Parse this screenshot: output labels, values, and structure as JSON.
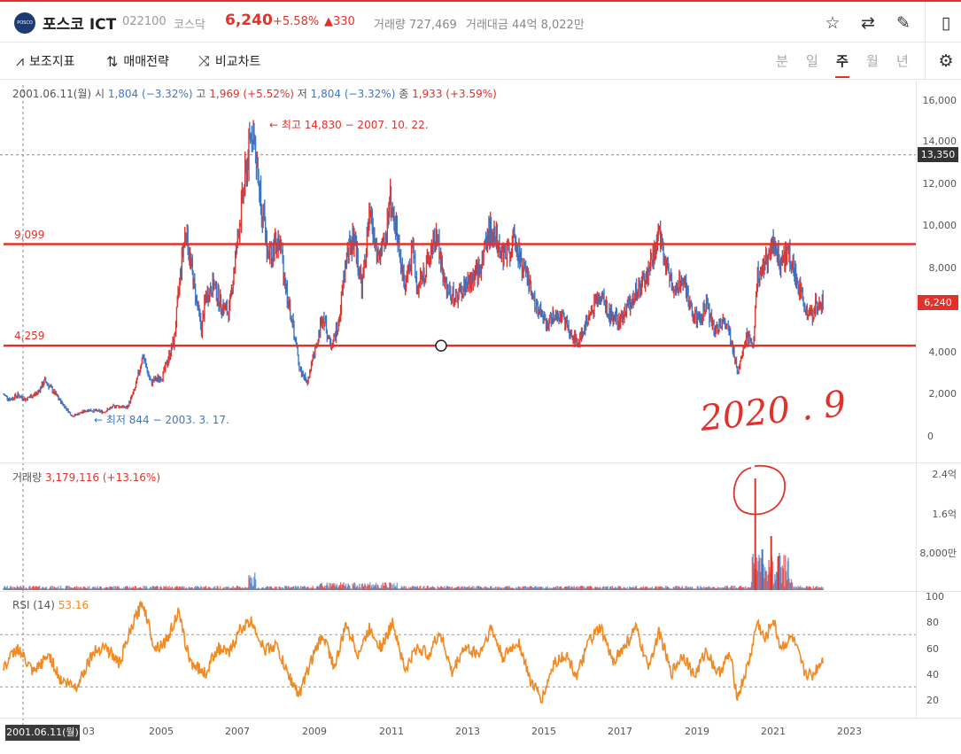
{
  "header": {
    "logo_text": "POSCO",
    "stock_name": "포스코 ICT",
    "stock_code": "022100",
    "market": "코스닥",
    "price": "6,240",
    "change_pct": "+5.58%",
    "change_abs": "▲330",
    "volume_label": "거래량 727,469",
    "amount_label": "거래대금 44억 8,022만",
    "icons": [
      "star-icon",
      "swap-icon",
      "edit-icon",
      "panel-icon"
    ]
  },
  "toolbar": {
    "indicator_label": "보조지표",
    "strategy_label": "매매전략",
    "compare_label": "비교차트",
    "periods": [
      "분",
      "일",
      "주",
      "월",
      "년"
    ],
    "active_period": "주"
  },
  "price_pane": {
    "info": {
      "date": "2001.06.11(월)",
      "open_label": "시",
      "open": "1,804 (−3.32%)",
      "high_label": "고",
      "high": "1,969 (+5.52%)",
      "low_label": "저",
      "low": "1,804 (−3.32%)",
      "close_label": "종",
      "close": "1,933 (+3.59%)"
    },
    "max_annotation": "← 최고 14,830 − 2007. 10. 22.",
    "min_annotation": "← 최저 844 − 2003. 3. 17.",
    "line_upper": "9,099",
    "line_lower": "4,259",
    "crosshair_price": "13,350",
    "current_price": "6,240",
    "handwritten_note": "2020 . 9",
    "y_ticks": [
      "16,000",
      "14,000",
      "12,000",
      "10,000",
      "8,000",
      "6,000",
      "4,000",
      "2,000",
      "0"
    ]
  },
  "volume_pane": {
    "label": "거래량",
    "value": "3,179,116 (+13.16%)",
    "y_ticks": [
      "2.4억",
      "1.6억",
      "8,000만"
    ]
  },
  "rsi_pane": {
    "label": "RSI (14)",
    "value": "53.16",
    "y_ticks": [
      "100",
      "80",
      "60",
      "40",
      "20"
    ]
  },
  "x_axis": {
    "date_tag": "2001.06.11(월)",
    "labels": [
      "03",
      "2005",
      "2007",
      "2009",
      "2011",
      "2013",
      "2015",
      "2017",
      "2019",
      "2021",
      "2023"
    ]
  },
  "colors": {
    "up": "#e0322b",
    "down": "#3b78c9",
    "rsi": "#f08a24",
    "support_line": "#e0322b"
  },
  "chart_data": {
    "type": "line",
    "title": "",
    "x_start": 2001.44,
    "x_end": 2022.4,
    "series": [
      {
        "name": "",
        "points": [
          [
            2001.44,
            1933
          ],
          [
            2001.6,
            1700
          ],
          [
            2001.8,
            1900
          ],
          [
            2002.0,
            1700
          ],
          [
            2002.3,
            2000
          ],
          [
            2002.5,
            2600
          ],
          [
            2002.7,
            2100
          ],
          [
            2002.9,
            1600
          ],
          [
            2003.2,
            900
          ],
          [
            2003.6,
            1200
          ],
          [
            2004.0,
            1100
          ],
          [
            2004.3,
            1400
          ],
          [
            2004.6,
            1300
          ],
          [
            2004.8,
            2200
          ],
          [
            2005.0,
            3800
          ],
          [
            2005.2,
            2500
          ],
          [
            2005.5,
            2800
          ],
          [
            2005.8,
            4500
          ],
          [
            2006.0,
            8500
          ],
          [
            2006.1,
            9800
          ],
          [
            2006.3,
            7200
          ],
          [
            2006.5,
            5000
          ],
          [
            2006.6,
            6500
          ],
          [
            2006.8,
            7200
          ],
          [
            2007.0,
            6200
          ],
          [
            2007.2,
            5800
          ],
          [
            2007.4,
            9000
          ],
          [
            2007.6,
            12000
          ],
          [
            2007.8,
            14830
          ],
          [
            2007.9,
            13000
          ],
          [
            2008.0,
            11500
          ],
          [
            2008.2,
            8600
          ],
          [
            2008.5,
            9200
          ],
          [
            2008.7,
            6500
          ],
          [
            2008.9,
            4500
          ],
          [
            2009.0,
            3200
          ],
          [
            2009.2,
            2500
          ],
          [
            2009.4,
            4000
          ],
          [
            2009.6,
            5800
          ],
          [
            2009.8,
            4200
          ],
          [
            2010.0,
            5200
          ],
          [
            2010.2,
            8500
          ],
          [
            2010.4,
            9500
          ],
          [
            2010.6,
            7000
          ],
          [
            2010.8,
            10500
          ],
          [
            2011.0,
            8500
          ],
          [
            2011.2,
            9000
          ],
          [
            2011.3,
            11500
          ],
          [
            2011.5,
            9500
          ],
          [
            2011.7,
            7000
          ],
          [
            2011.9,
            9000
          ],
          [
            2012.0,
            7000
          ],
          [
            2012.3,
            8200
          ],
          [
            2012.5,
            9600
          ],
          [
            2012.7,
            7200
          ],
          [
            2013.0,
            6500
          ],
          [
            2013.3,
            7200
          ],
          [
            2013.6,
            7800
          ],
          [
            2013.8,
            9500
          ],
          [
            2014.0,
            9800
          ],
          [
            2014.2,
            8500
          ],
          [
            2014.5,
            9200
          ],
          [
            2014.8,
            7500
          ],
          [
            2015.0,
            6500
          ],
          [
            2015.3,
            5200
          ],
          [
            2015.6,
            5800
          ],
          [
            2015.9,
            5000
          ],
          [
            2016.1,
            4300
          ],
          [
            2016.4,
            5600
          ],
          [
            2016.7,
            6800
          ],
          [
            2016.9,
            5800
          ],
          [
            2017.2,
            5400
          ],
          [
            2017.5,
            6500
          ],
          [
            2017.8,
            7200
          ],
          [
            2018.0,
            8200
          ],
          [
            2018.2,
            9500
          ],
          [
            2018.4,
            8000
          ],
          [
            2018.6,
            7000
          ],
          [
            2018.8,
            7500
          ],
          [
            2019.0,
            6000
          ],
          [
            2019.2,
            5500
          ],
          [
            2019.4,
            6200
          ],
          [
            2019.6,
            5000
          ],
          [
            2019.8,
            5400
          ],
          [
            2020.0,
            4800
          ],
          [
            2020.2,
            3000
          ],
          [
            2020.4,
            4700
          ],
          [
            2020.6,
            4300
          ],
          [
            2020.7,
            7500
          ],
          [
            2020.9,
            8200
          ],
          [
            2021.0,
            8500
          ],
          [
            2021.1,
            9300
          ],
          [
            2021.3,
            8000
          ],
          [
            2021.5,
            8800
          ],
          [
            2021.7,
            7500
          ],
          [
            2021.9,
            6200
          ],
          [
            2022.1,
            5600
          ],
          [
            2022.2,
            6200
          ],
          [
            2022.4,
            6240
          ]
        ]
      }
    ],
    "volume_spike": {
      "x": 2020.65,
      "value_label": "2.4억"
    },
    "rsi_series": {
      "points": [
        [
          2001.44,
          45
        ],
        [
          2001.8,
          60
        ],
        [
          2002.2,
          40
        ],
        [
          2002.6,
          55
        ],
        [
          2002.9,
          35
        ],
        [
          2003.3,
          30
        ],
        [
          2003.7,
          55
        ],
        [
          2004.0,
          62
        ],
        [
          2004.4,
          48
        ],
        [
          2004.8,
          82
        ],
        [
          2005.0,
          95
        ],
        [
          2005.3,
          60
        ],
        [
          2005.6,
          65
        ],
        [
          2005.9,
          87
        ],
        [
          2006.2,
          50
        ],
        [
          2006.6,
          40
        ],
        [
          2006.9,
          60
        ],
        [
          2007.2,
          55
        ],
        [
          2007.5,
          75
        ],
        [
          2007.8,
          80
        ],
        [
          2008.1,
          58
        ],
        [
          2008.4,
          62
        ],
        [
          2008.7,
          40
        ],
        [
          2009.0,
          24
        ],
        [
          2009.3,
          50
        ],
        [
          2009.6,
          70
        ],
        [
          2009.9,
          45
        ],
        [
          2010.2,
          78
        ],
        [
          2010.5,
          55
        ],
        [
          2010.8,
          75
        ],
        [
          2011.1,
          60
        ],
        [
          2011.4,
          80
        ],
        [
          2011.7,
          42
        ],
        [
          2012.0,
          60
        ],
        [
          2012.3,
          55
        ],
        [
          2012.6,
          72
        ],
        [
          2012.9,
          40
        ],
        [
          2013.2,
          60
        ],
        [
          2013.6,
          55
        ],
        [
          2013.9,
          75
        ],
        [
          2014.2,
          52
        ],
        [
          2014.6,
          65
        ],
        [
          2014.9,
          35
        ],
        [
          2015.2,
          20
        ],
        [
          2015.5,
          48
        ],
        [
          2015.8,
          55
        ],
        [
          2016.1,
          38
        ],
        [
          2016.4,
          65
        ],
        [
          2016.7,
          75
        ],
        [
          2017.0,
          50
        ],
        [
          2017.3,
          60
        ],
        [
          2017.6,
          75
        ],
        [
          2017.9,
          45
        ],
        [
          2018.2,
          72
        ],
        [
          2018.5,
          40
        ],
        [
          2018.8,
          55
        ],
        [
          2019.1,
          38
        ],
        [
          2019.4,
          58
        ],
        [
          2019.7,
          40
        ],
        [
          2020.0,
          55
        ],
        [
          2020.2,
          22
        ],
        [
          2020.5,
          50
        ],
        [
          2020.7,
          80
        ],
        [
          2020.9,
          65
        ],
        [
          2021.1,
          82
        ],
        [
          2021.3,
          60
        ],
        [
          2021.6,
          68
        ],
        [
          2021.9,
          42
        ],
        [
          2022.1,
          38
        ],
        [
          2022.4,
          53.16
        ]
      ]
    },
    "x_axis": {
      "ticks": [
        2003,
        2005,
        2007,
        2009,
        2011,
        2013,
        2015,
        2017,
        2019,
        2021,
        2023
      ]
    },
    "y_axis": {
      "range": [
        0,
        16000
      ]
    }
  }
}
